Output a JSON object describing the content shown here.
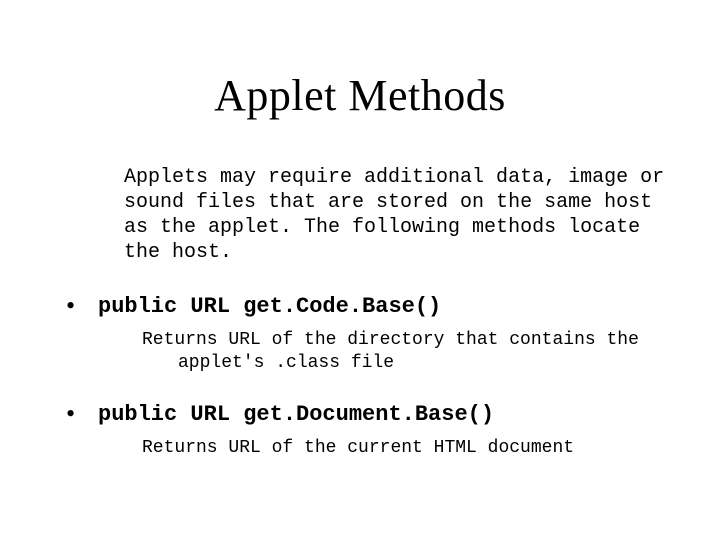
{
  "title": "Applet Methods",
  "intro": "Applets may require additional data, image or sound files that are stored on the same host as the applet.  The following methods locate the host.",
  "methods": [
    {
      "signature": "public URL get.Code.Base()",
      "description": "Returns URL of the directory that contains the applet's .class file"
    },
    {
      "signature": "public URL get.Document.Base()",
      "description": "Returns URL of the current HTML document"
    }
  ]
}
